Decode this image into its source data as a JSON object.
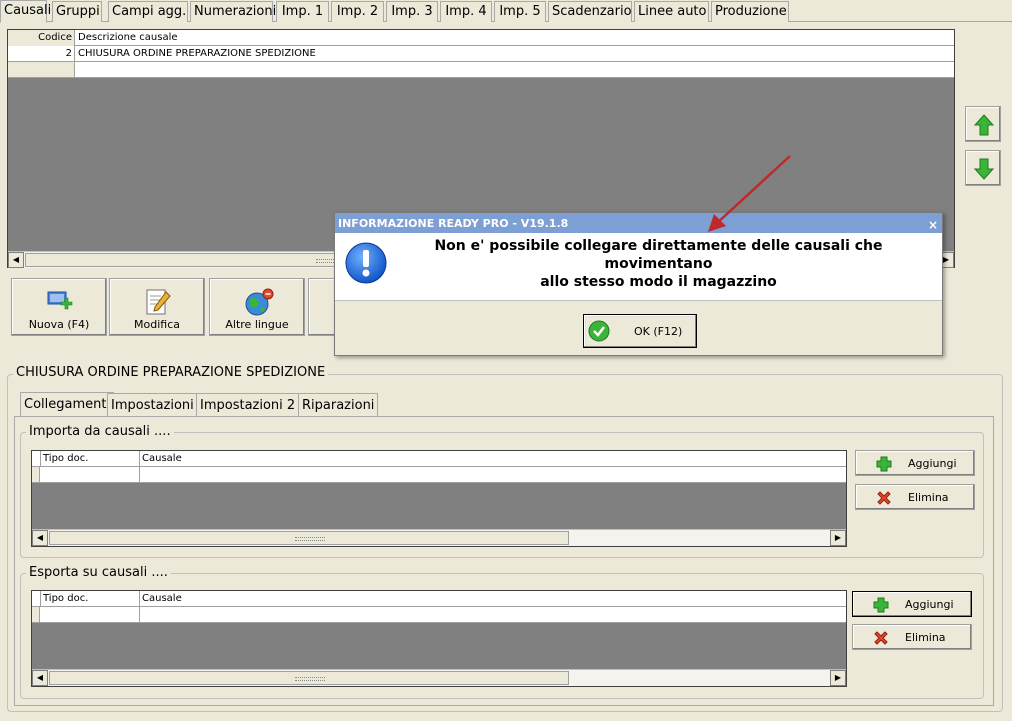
{
  "tabs": [
    "Causali",
    "Gruppi",
    "Campi agg.",
    "Numerazioni",
    "Imp. 1",
    "Imp. 2",
    "Imp. 3",
    "Imp. 4",
    "Imp. 5",
    "Scadenzario",
    "Linee auto",
    "Produzione"
  ],
  "causali_grid": {
    "columns": [
      "Codice",
      "Descrizione causale"
    ],
    "rows": [
      {
        "codice": "2",
        "descrizione": "CHIUSURA ORDINE PREPARAZIONE SPEDIZIONE"
      }
    ]
  },
  "toolbar": {
    "nuova_label": "Nuova (F4)",
    "modifica_label": "Modifica",
    "altre_lingue_label": "Altre lingue"
  },
  "detail": {
    "title": "CHIUSURA ORDINE PREPARAZIONE SPEDIZIONE",
    "subtabs": [
      "Collegamenti",
      "Impostazioni",
      "Impostazioni 2",
      "Riparazioni"
    ],
    "importa": {
      "legend": "Importa da causali ....",
      "columns": [
        "Tipo doc.",
        "Causale"
      ],
      "add_label": "Aggiungi",
      "delete_label": "Elimina"
    },
    "esporta": {
      "legend": "Esporta su causali ....",
      "columns": [
        "Tipo doc.",
        "Causale"
      ],
      "add_label": "Aggiungi",
      "delete_label": "Elimina"
    }
  },
  "dialog": {
    "title": "INFORMAZIONE READY PRO - V19.1.8",
    "close_glyph": "×",
    "message_line1": "Non e' possibile collegare direttamente delle causali che movimentano",
    "message_line2": "allo stesso modo il magazzino",
    "ok_label": "OK (F12)"
  },
  "colors": {
    "dialog_title_bg": "#7d9fd3",
    "grid_empty_bg": "#808080",
    "window_bg": "#ece9d8",
    "annotation_arrow": "#c0282b"
  }
}
